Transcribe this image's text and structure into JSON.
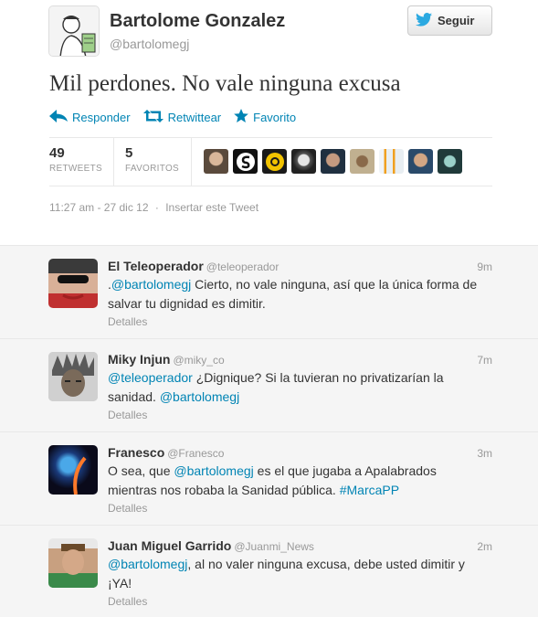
{
  "author": {
    "name": "Bartolome Gonzalez",
    "handle": "@bartolomegj",
    "follow_label": "Seguir"
  },
  "tweet": {
    "text": "Mil perdones. No vale ninguna excusa",
    "actions": {
      "reply": "Responder",
      "retweet": "Retwittear",
      "favorite": "Favorito"
    },
    "stats": {
      "retweets_count": "49",
      "retweets_label": "RETWEETS",
      "favorites_count": "5",
      "favorites_label": "FAVORITOS"
    },
    "timestamp": "11:27 am - 27 dic 12",
    "separator": "·",
    "embed_label": "Insertar este Tweet"
  },
  "replies": [
    {
      "name": "El Teleoperador",
      "handle": "@teleoperador",
      "time": "9m",
      "segments": [
        {
          "t": ".",
          "link": false
        },
        {
          "t": "@bartolomegj",
          "link": true
        },
        {
          "t": " Cierto, no vale ninguna, así que la única forma de salvar tu dignidad es dimitir.",
          "link": false
        }
      ],
      "details": "Detalles"
    },
    {
      "name": "Miky Injun",
      "handle": "@miky_co",
      "time": "7m",
      "segments": [
        {
          "t": "@teleoperador",
          "link": true
        },
        {
          "t": " ¿Dignique? Si la tuvieran no privatizarían la sanidad. ",
          "link": false
        },
        {
          "t": "@bartolomegj",
          "link": true
        }
      ],
      "details": "Detalles"
    },
    {
      "name": "Franesco",
      "handle": "@Franesco",
      "time": "3m",
      "segments": [
        {
          "t": "O sea, que ",
          "link": false
        },
        {
          "t": "@bartolomegj",
          "link": true
        },
        {
          "t": " es el que jugaba a Apalabrados mientras nos robaba la Sanidad pública. ",
          "link": false
        },
        {
          "t": "#MarcaPP",
          "link": true
        }
      ],
      "details": "Detalles"
    },
    {
      "name": "Juan Miguel Garrido",
      "handle": "@Juanmi_News",
      "time": "2m",
      "segments": [
        {
          "t": "@bartolomegj",
          "link": true
        },
        {
          "t": ", al no valer ninguna excusa, debe usted dimitir y ¡YA!",
          "link": false
        }
      ],
      "details": "Detalles"
    }
  ],
  "colors": {
    "link": "#0084b4",
    "muted": "#999999",
    "reply_bg": "#f5f5f5"
  }
}
